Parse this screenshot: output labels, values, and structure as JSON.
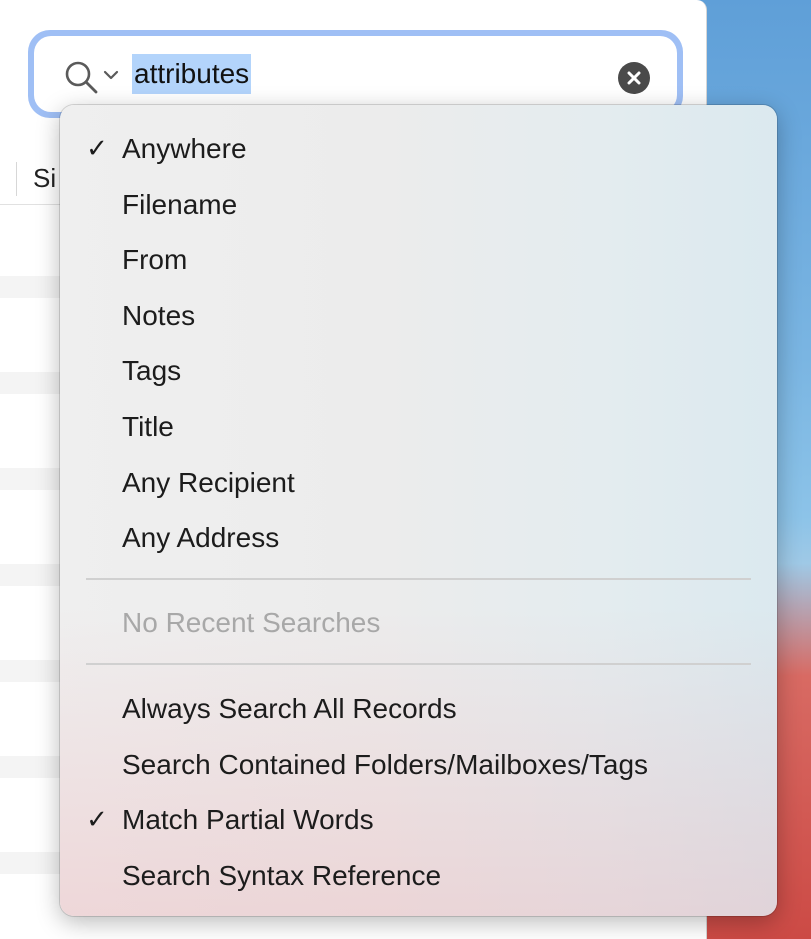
{
  "search": {
    "query": "attributes"
  },
  "list": {
    "column_header_fragment": "Si"
  },
  "menu": {
    "scope_items": [
      {
        "label": "Anywhere",
        "checked": true
      },
      {
        "label": "Filename",
        "checked": false
      },
      {
        "label": "From",
        "checked": false
      },
      {
        "label": "Notes",
        "checked": false
      },
      {
        "label": "Tags",
        "checked": false
      },
      {
        "label": "Title",
        "checked": false
      },
      {
        "label": "Any Recipient",
        "checked": false
      },
      {
        "label": "Any Address",
        "checked": false
      }
    ],
    "recent_placeholder": "No Recent Searches",
    "option_items": [
      {
        "label": "Always Search All Records",
        "checked": false
      },
      {
        "label": "Search Contained Folders/Mailboxes/Tags",
        "checked": false
      },
      {
        "label": "Match Partial Words",
        "checked": true
      },
      {
        "label": "Search Syntax Reference",
        "checked": false
      }
    ],
    "check_glyph": "✓"
  }
}
